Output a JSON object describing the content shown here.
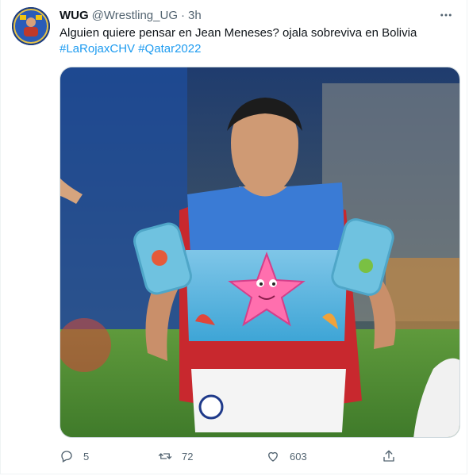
{
  "tweet": {
    "display_name": "WUG",
    "handle": "@Wrestling_UG",
    "separator": "·",
    "time": "3h",
    "text": "Alguien quiere pensar en Jean Meneses? ojala sobreviva en Bolivia",
    "hashtags": [
      "#LaRojaxCHV",
      "#Qatar2022"
    ],
    "more_icon": "more-horizontal-icon",
    "media_description": "Chilean football player in red jersey wearing inflatable swim vest with pink starfish and arm floaties",
    "stats": {
      "replies": "5",
      "retweets": "72",
      "likes": "603"
    }
  },
  "colors": {
    "accent": "#1d9bf0",
    "secondary_text": "#536471",
    "border": "#cfd9de"
  }
}
